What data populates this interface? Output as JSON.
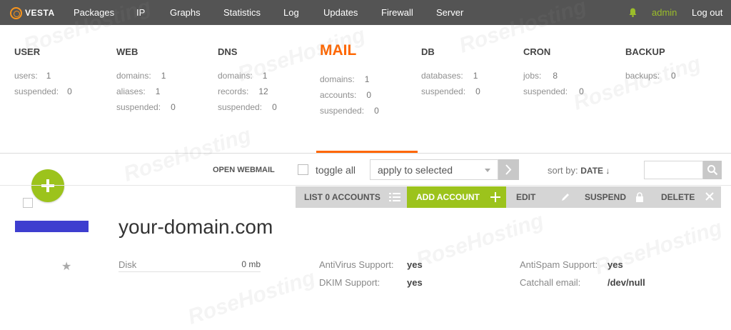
{
  "nav": {
    "logo_text": "VESTA",
    "items": [
      "Packages",
      "IP",
      "Graphs",
      "Statistics",
      "Log",
      "Updates",
      "Firewall",
      "Server"
    ],
    "user": "admin",
    "logout": "Log out"
  },
  "stats": [
    {
      "title": "USER",
      "rows": [
        {
          "label": "users:",
          "value": "1"
        },
        {
          "label": "suspended:",
          "value": "0"
        }
      ]
    },
    {
      "title": "WEB",
      "rows": [
        {
          "label": "domains:",
          "value": "1"
        },
        {
          "label": "aliases:",
          "value": "1"
        },
        {
          "label": "suspended:",
          "value": "0"
        }
      ]
    },
    {
      "title": "DNS",
      "rows": [
        {
          "label": "domains:",
          "value": "1"
        },
        {
          "label": "records:",
          "value": "12"
        },
        {
          "label": "suspended:",
          "value": "0"
        }
      ]
    },
    {
      "title": "MAIL",
      "rows": [
        {
          "label": "domains:",
          "value": "1"
        },
        {
          "label": "accounts:",
          "value": "0"
        },
        {
          "label": "suspended:",
          "value": "0"
        }
      ]
    },
    {
      "title": "DB",
      "rows": [
        {
          "label": "databases:",
          "value": "1"
        },
        {
          "label": "suspended:",
          "value": "0"
        }
      ]
    },
    {
      "title": "CRON",
      "rows": [
        {
          "label": "jobs:",
          "value": "8"
        },
        {
          "label": "suspended:",
          "value": "0"
        }
      ]
    },
    {
      "title": "BACKUP",
      "rows": [
        {
          "label": "backups:",
          "value": "0"
        }
      ]
    }
  ],
  "toolbar": {
    "open_webmail": "OPEN WEBMAIL",
    "toggle_all": "toggle all",
    "apply_selected": "apply to selected",
    "sort_by_label": "sort by:",
    "sort_by_value": "DATE ↓"
  },
  "actions": {
    "list_accounts": "LIST 0 ACCOUNTS",
    "add_account": "ADD ACCOUNT",
    "edit": "EDIT",
    "suspend": "SUSPEND",
    "delete": "DELETE"
  },
  "domain": {
    "name": "your-domain.com",
    "disk_label": "Disk",
    "disk_value": "0 mb",
    "antivirus_label": "AntiVirus Support:",
    "antivirus_value": "yes",
    "dkim_label": "DKIM Support:",
    "dkim_value": "yes",
    "antispam_label": "AntiSpam Support:",
    "antispam_value": "yes",
    "catchall_label": "Catchall email:",
    "catchall_value": "/dev/null"
  },
  "watermark": "RoseHosting",
  "colors": {
    "nav_bg": "#545454",
    "accent_orange": "#ff6701",
    "accent_green": "#9cc31c",
    "domain_bar": "#3e3ecf"
  }
}
